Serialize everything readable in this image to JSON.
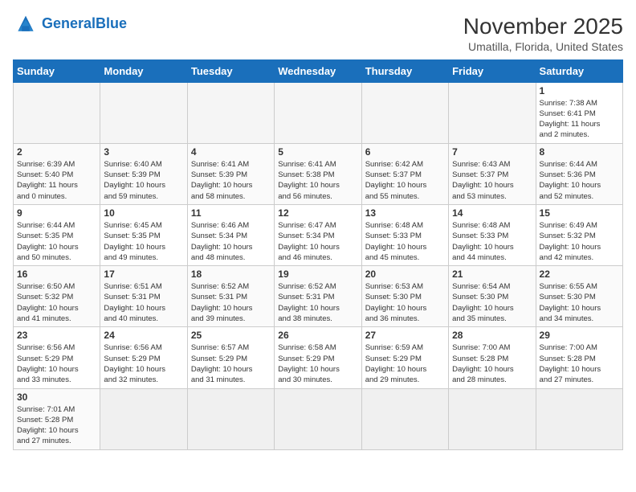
{
  "logo": {
    "text_general": "General",
    "text_blue": "Blue"
  },
  "header": {
    "month_year": "November 2025",
    "location": "Umatilla, Florida, United States"
  },
  "weekdays": [
    "Sunday",
    "Monday",
    "Tuesday",
    "Wednesday",
    "Thursday",
    "Friday",
    "Saturday"
  ],
  "weeks": [
    [
      {
        "day": "",
        "info": ""
      },
      {
        "day": "",
        "info": ""
      },
      {
        "day": "",
        "info": ""
      },
      {
        "day": "",
        "info": ""
      },
      {
        "day": "",
        "info": ""
      },
      {
        "day": "",
        "info": ""
      },
      {
        "day": "1",
        "info": "Sunrise: 7:38 AM\nSunset: 6:41 PM\nDaylight: 11 hours\nand 2 minutes."
      }
    ],
    [
      {
        "day": "2",
        "info": "Sunrise: 6:39 AM\nSunset: 5:40 PM\nDaylight: 11 hours\nand 0 minutes."
      },
      {
        "day": "3",
        "info": "Sunrise: 6:40 AM\nSunset: 5:39 PM\nDaylight: 10 hours\nand 59 minutes."
      },
      {
        "day": "4",
        "info": "Sunrise: 6:41 AM\nSunset: 5:39 PM\nDaylight: 10 hours\nand 58 minutes."
      },
      {
        "day": "5",
        "info": "Sunrise: 6:41 AM\nSunset: 5:38 PM\nDaylight: 10 hours\nand 56 minutes."
      },
      {
        "day": "6",
        "info": "Sunrise: 6:42 AM\nSunset: 5:37 PM\nDaylight: 10 hours\nand 55 minutes."
      },
      {
        "day": "7",
        "info": "Sunrise: 6:43 AM\nSunset: 5:37 PM\nDaylight: 10 hours\nand 53 minutes."
      },
      {
        "day": "8",
        "info": "Sunrise: 6:44 AM\nSunset: 5:36 PM\nDaylight: 10 hours\nand 52 minutes."
      }
    ],
    [
      {
        "day": "9",
        "info": "Sunrise: 6:44 AM\nSunset: 5:35 PM\nDaylight: 10 hours\nand 50 minutes."
      },
      {
        "day": "10",
        "info": "Sunrise: 6:45 AM\nSunset: 5:35 PM\nDaylight: 10 hours\nand 49 minutes."
      },
      {
        "day": "11",
        "info": "Sunrise: 6:46 AM\nSunset: 5:34 PM\nDaylight: 10 hours\nand 48 minutes."
      },
      {
        "day": "12",
        "info": "Sunrise: 6:47 AM\nSunset: 5:34 PM\nDaylight: 10 hours\nand 46 minutes."
      },
      {
        "day": "13",
        "info": "Sunrise: 6:48 AM\nSunset: 5:33 PM\nDaylight: 10 hours\nand 45 minutes."
      },
      {
        "day": "14",
        "info": "Sunrise: 6:48 AM\nSunset: 5:33 PM\nDaylight: 10 hours\nand 44 minutes."
      },
      {
        "day": "15",
        "info": "Sunrise: 6:49 AM\nSunset: 5:32 PM\nDaylight: 10 hours\nand 42 minutes."
      }
    ],
    [
      {
        "day": "16",
        "info": "Sunrise: 6:50 AM\nSunset: 5:32 PM\nDaylight: 10 hours\nand 41 minutes."
      },
      {
        "day": "17",
        "info": "Sunrise: 6:51 AM\nSunset: 5:31 PM\nDaylight: 10 hours\nand 40 minutes."
      },
      {
        "day": "18",
        "info": "Sunrise: 6:52 AM\nSunset: 5:31 PM\nDaylight: 10 hours\nand 39 minutes."
      },
      {
        "day": "19",
        "info": "Sunrise: 6:52 AM\nSunset: 5:31 PM\nDaylight: 10 hours\nand 38 minutes."
      },
      {
        "day": "20",
        "info": "Sunrise: 6:53 AM\nSunset: 5:30 PM\nDaylight: 10 hours\nand 36 minutes."
      },
      {
        "day": "21",
        "info": "Sunrise: 6:54 AM\nSunset: 5:30 PM\nDaylight: 10 hours\nand 35 minutes."
      },
      {
        "day": "22",
        "info": "Sunrise: 6:55 AM\nSunset: 5:30 PM\nDaylight: 10 hours\nand 34 minutes."
      }
    ],
    [
      {
        "day": "23",
        "info": "Sunrise: 6:56 AM\nSunset: 5:29 PM\nDaylight: 10 hours\nand 33 minutes."
      },
      {
        "day": "24",
        "info": "Sunrise: 6:56 AM\nSunset: 5:29 PM\nDaylight: 10 hours\nand 32 minutes."
      },
      {
        "day": "25",
        "info": "Sunrise: 6:57 AM\nSunset: 5:29 PM\nDaylight: 10 hours\nand 31 minutes."
      },
      {
        "day": "26",
        "info": "Sunrise: 6:58 AM\nSunset: 5:29 PM\nDaylight: 10 hours\nand 30 minutes."
      },
      {
        "day": "27",
        "info": "Sunrise: 6:59 AM\nSunset: 5:29 PM\nDaylight: 10 hours\nand 29 minutes."
      },
      {
        "day": "28",
        "info": "Sunrise: 7:00 AM\nSunset: 5:28 PM\nDaylight: 10 hours\nand 28 minutes."
      },
      {
        "day": "29",
        "info": "Sunrise: 7:00 AM\nSunset: 5:28 PM\nDaylight: 10 hours\nand 27 minutes."
      }
    ],
    [
      {
        "day": "30",
        "info": "Sunrise: 7:01 AM\nSunset: 5:28 PM\nDaylight: 10 hours\nand 27 minutes."
      },
      {
        "day": "",
        "info": ""
      },
      {
        "day": "",
        "info": ""
      },
      {
        "day": "",
        "info": ""
      },
      {
        "day": "",
        "info": ""
      },
      {
        "day": "",
        "info": ""
      },
      {
        "day": "",
        "info": ""
      }
    ]
  ]
}
